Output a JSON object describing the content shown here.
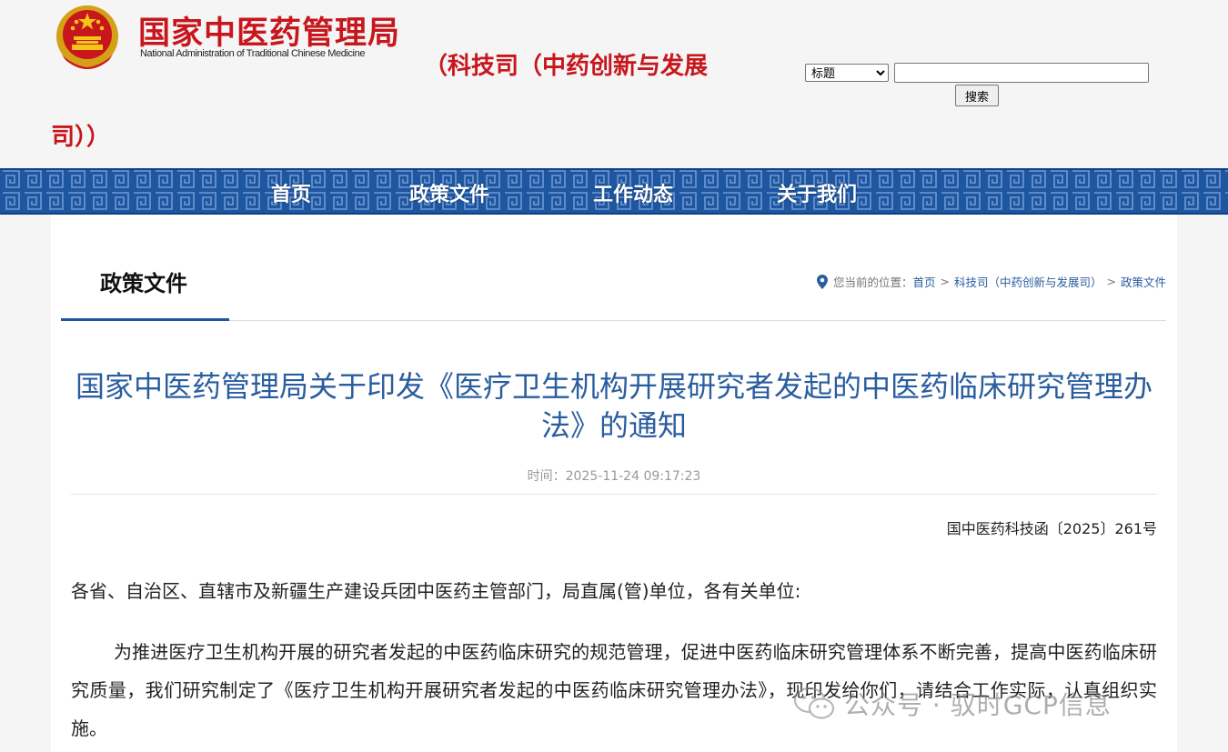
{
  "header": {
    "agency_cn": "国家中医药管理局",
    "agency_en": "National Administration of Traditional Chinese Medicine",
    "department_line1": "（科技司（中药创新与发展",
    "department_line2": "司））"
  },
  "search": {
    "field_selected": "标题",
    "query": "",
    "button_label": "搜索"
  },
  "nav": {
    "items": [
      {
        "label": "首页"
      },
      {
        "label": "政策文件"
      },
      {
        "label": "工作动态"
      },
      {
        "label": "关于我们"
      }
    ]
  },
  "section": {
    "title": "政策文件"
  },
  "breadcrumb": {
    "prefix": "您当前的位置：",
    "items": [
      "首页",
      "科技司（中药创新与发展司）",
      "政策文件"
    ],
    "separator": ">"
  },
  "article": {
    "title": "国家中医药管理局关于印发《医疗卫生机构开展研究者发起的中医药临床研究管理办法》的通知",
    "time": "时间：2025-11-24 09:17:23",
    "doc_number": "国中医药科技函〔2025〕261号",
    "salutation": "各省、自治区、直辖市及新疆生产建设兵团中医药主管部门，局直属(管)单位，各有关单位:",
    "paragraph1": "为推进医疗卫生机构开展的研究者发起的中医药临床研究的规范管理，促进中医药临床研究管理体系不断完善，提高中医药临床研究质量，我们研究制定了《医疗卫生机构开展研究者发起的中医药临床研究管理办法》，现印发给你们，请结合工作实际，认真组织实施。"
  },
  "watermark": {
    "text": "公众号 · 驭时GCP信息"
  },
  "colors": {
    "brand_red": "#c8161d",
    "nav_blue": "#1e56a0",
    "link_blue": "#2a5d9f"
  }
}
